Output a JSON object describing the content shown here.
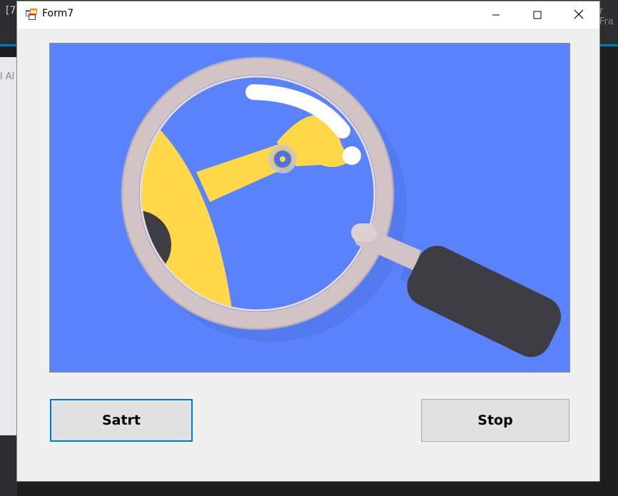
{
  "window": {
    "title": "Form7",
    "icons": {
      "app": "app-form-icon",
      "minimize": "minimize-icon",
      "maximize": "maximize-icon",
      "close": "close-icon"
    }
  },
  "background": {
    "left_text": "[7",
    "left_text2": "l Al",
    "right_text": "r Fra"
  },
  "picture": {
    "description_icon": "magnifier-illustration",
    "colors": {
      "sky": "#5a82fa",
      "yellow": "#ffd84a",
      "ring": "#d2c4c4",
      "handle": "#3f3d44"
    }
  },
  "buttons": {
    "start_label": "Satrt",
    "stop_label": "Stop"
  }
}
